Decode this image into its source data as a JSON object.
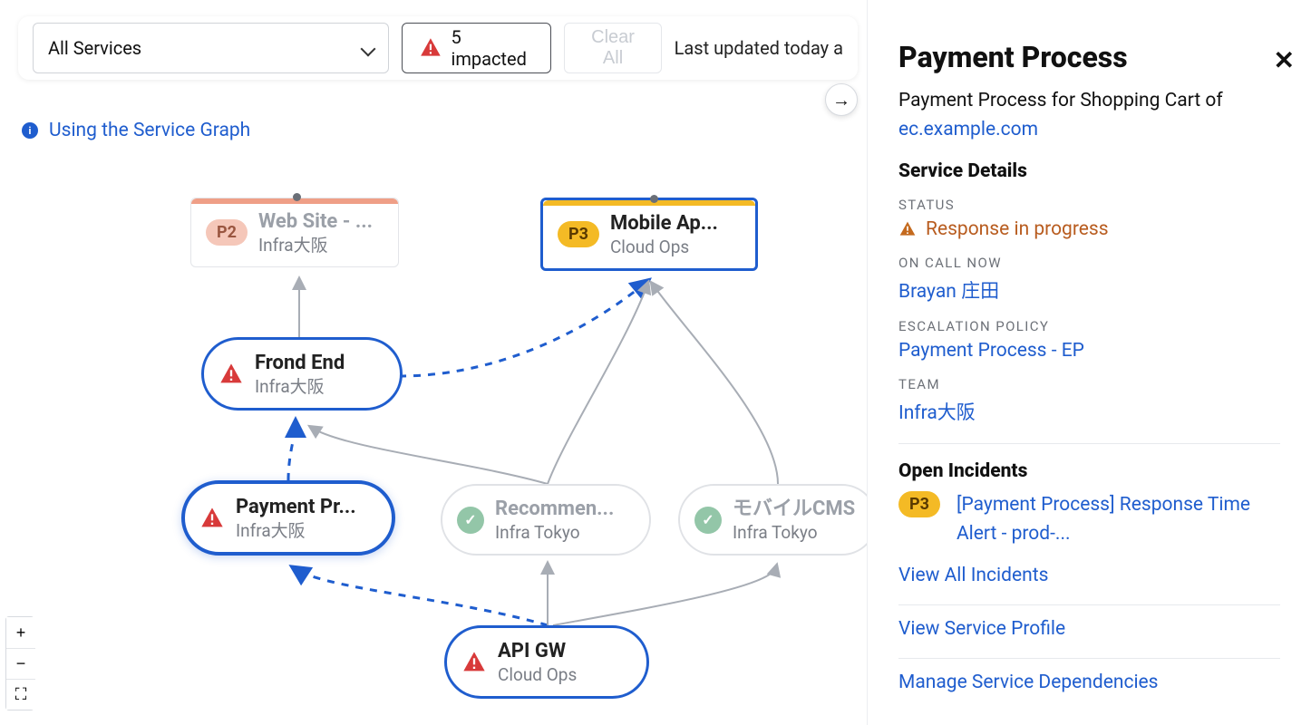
{
  "topbar": {
    "select_label": "All Services",
    "impacted_label": "5 impacted",
    "clear_label": "Clear All",
    "last_updated": "Last updated today a"
  },
  "info_link": "Using the Service Graph",
  "nodes": {
    "website": {
      "name": "Web Site - ...",
      "team": "Infra大阪",
      "badge": "P2"
    },
    "mobile": {
      "name": "Mobile Ap...",
      "team": "Cloud Ops",
      "badge": "P3"
    },
    "frontend": {
      "name": "Frond End",
      "team": "Infra大阪"
    },
    "payment": {
      "name": "Payment Pr...",
      "team": "Infra大阪"
    },
    "recommend": {
      "name": "Recommen...",
      "team": "Infra Tokyo"
    },
    "mobilecms": {
      "name": "モバイルCMS",
      "team": "Infra Tokyo"
    },
    "apigw": {
      "name": "API GW",
      "team": "Cloud Ops"
    }
  },
  "panel": {
    "title": "Payment Process",
    "desc_prefix": "Payment Process for Shopping Cart of ",
    "desc_link": "ec.example.com",
    "section_details": "Service Details",
    "labels": {
      "status": "STATUS",
      "oncall": "ON CALL NOW",
      "escalation": "ESCALATION POLICY",
      "team": "TEAM"
    },
    "status_text": "Response in progress",
    "oncall": "Brayan 庄田",
    "escalation": "Payment Process - EP",
    "team": "Infra大阪",
    "section_incidents": "Open Incidents",
    "incident": {
      "priority": "P3",
      "title": "[Payment Process] Response Time Alert - prod-..."
    },
    "links": {
      "view_all_incidents": "View All Incidents",
      "view_service_profile": "View Service Profile",
      "manage_deps": "Manage Service Dependencies"
    }
  },
  "zoom": {
    "plus": "+",
    "minus": "−",
    "full": "⛶"
  },
  "arrow": "→"
}
